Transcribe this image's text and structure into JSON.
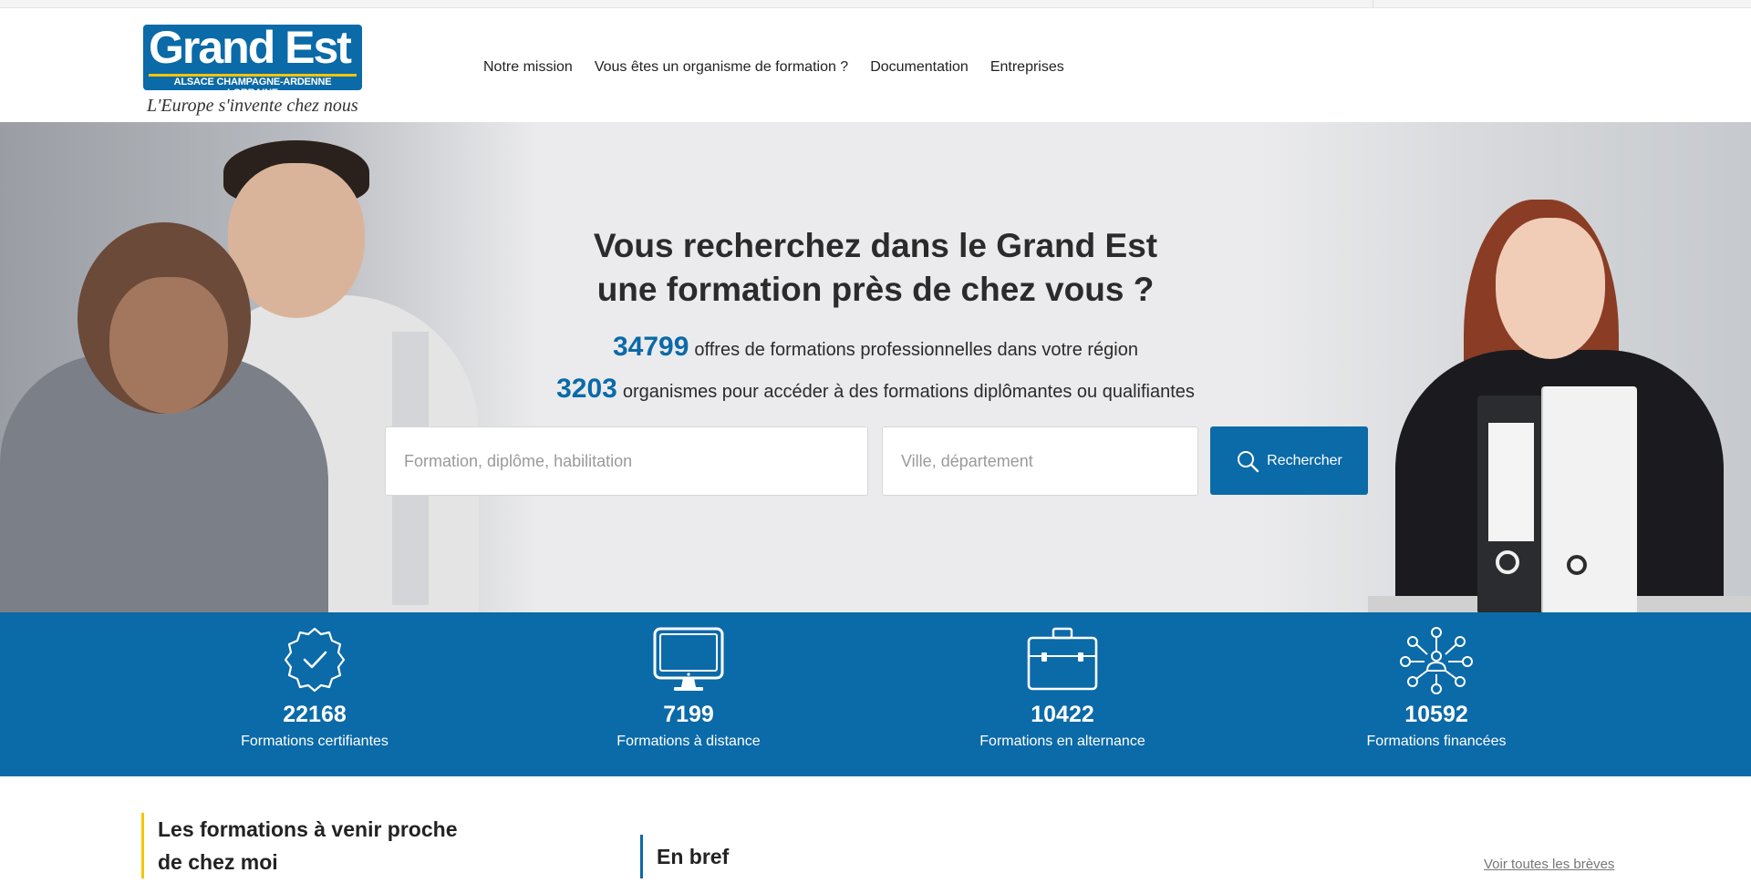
{
  "header": {
    "logo": {
      "name": "Grand Est",
      "subtitle": "ALSACE CHAMPAGNE-ARDENNE LORRAINE",
      "tagline": "L'Europe s'invente chez nous"
    },
    "nav": [
      {
        "label": "Notre mission"
      },
      {
        "label": "Vous êtes un organisme de formation ?"
      },
      {
        "label": "Documentation"
      },
      {
        "label": "Entreprises"
      }
    ]
  },
  "hero": {
    "title_line1": "Vous recherchez dans le Grand Est",
    "title_line2": "une formation près de chez vous ?",
    "stat1": {
      "value": "34799",
      "text": "offres de formations professionnelles dans votre région"
    },
    "stat2": {
      "value": "3203",
      "text": "organismes pour accéder à des formations diplômantes ou qualifiantes"
    },
    "search": {
      "formation_placeholder": "Formation, diplôme, habilitation",
      "formation_value": "",
      "ville_placeholder": "Ville, département",
      "ville_value": "",
      "button_label": "Rechercher"
    }
  },
  "stats": [
    {
      "icon": "certificate-badge-icon",
      "value": "22168",
      "label": "Formations certifiantes"
    },
    {
      "icon": "monitor-icon",
      "value": "7199",
      "label": "Formations à distance"
    },
    {
      "icon": "briefcase-icon",
      "value": "10422",
      "label": "Formations en alternance"
    },
    {
      "icon": "network-person-icon",
      "value": "10592",
      "label": "Formations financées"
    }
  ],
  "sections": {
    "upcoming_line1": "Les formations à venir proche",
    "upcoming_line2": "de chez moi",
    "en_bref": "En bref",
    "see_all": "Voir toutes les brèves"
  },
  "colors": {
    "brand_blue": "#0b6aa8",
    "accent_yellow": "#f5c400"
  }
}
